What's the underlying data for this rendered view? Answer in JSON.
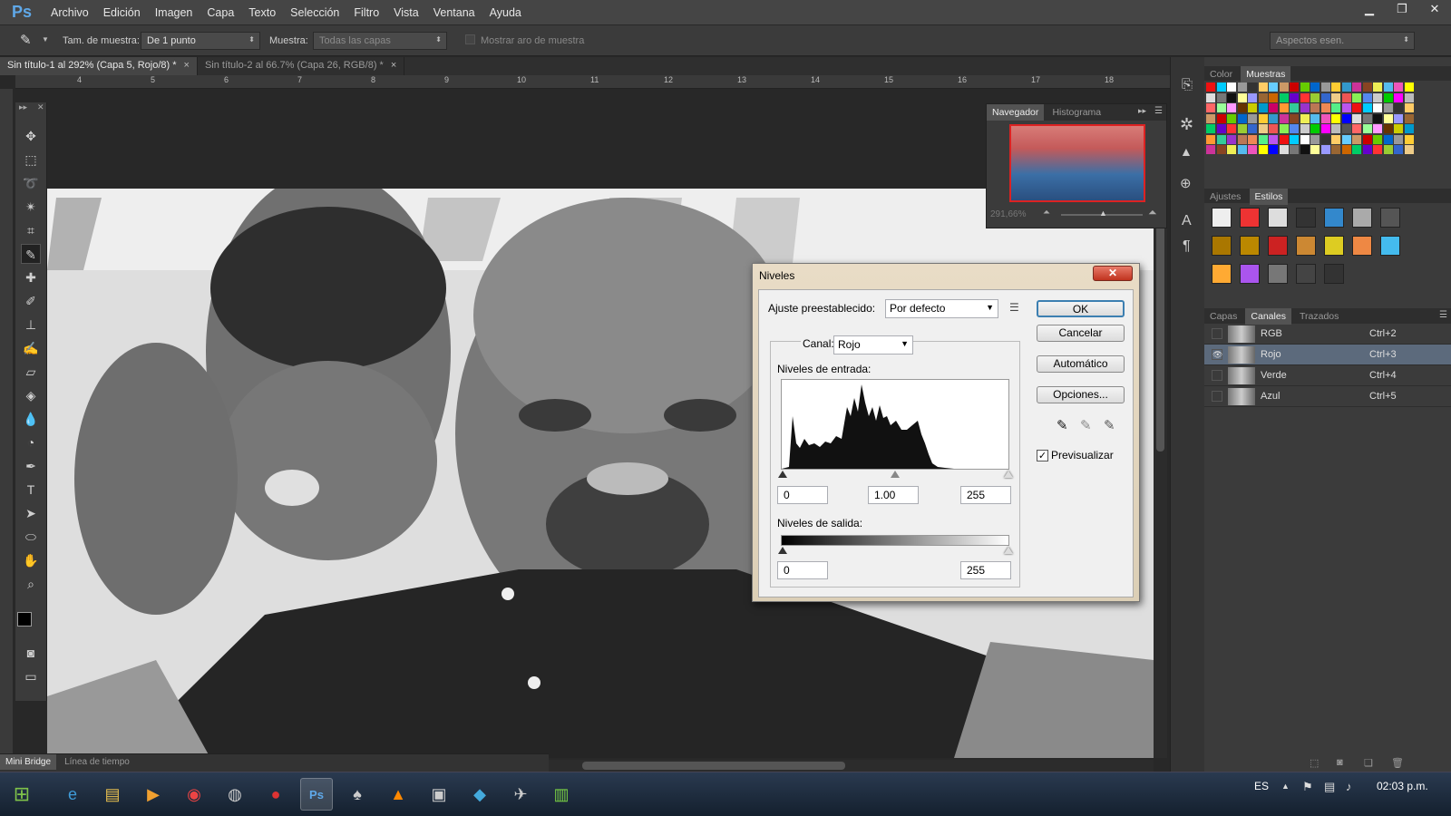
{
  "app": {
    "logo": "Ps"
  },
  "menu": [
    "Archivo",
    "Edición",
    "Imagen",
    "Capa",
    "Texto",
    "Selección",
    "Filtro",
    "Vista",
    "Ventana",
    "Ayuda"
  ],
  "options": {
    "sample_size_label": "Tam. de muestra:",
    "sample_size_value": "De 1 punto",
    "sample_label": "Muestra:",
    "sample_value": "Todas las capas",
    "show_ring_label": "Mostrar aro de muestra",
    "workspace_value": "Aspectos esen."
  },
  "doc_tabs": [
    {
      "label": "Sin título-1 al 292% (Capa 5, Rojo/8) *",
      "active": true
    },
    {
      "label": "Sin título-2 al 66.7% (Capa 26, RGB/8) *",
      "active": false
    }
  ],
  "ruler_ticks": [
    "4",
    "5",
    "6",
    "7",
    "8",
    "9",
    "10",
    "11",
    "12",
    "13",
    "14",
    "15",
    "16",
    "17",
    "18"
  ],
  "navigator": {
    "tabs": [
      "Navegador",
      "Histograma"
    ],
    "zoom": "291,66%"
  },
  "swatches_panel": {
    "tabs": [
      "Color",
      "Muestras"
    ]
  },
  "styles_panel": {
    "tabs": [
      "Ajustes",
      "Estilos"
    ]
  },
  "channels_panel": {
    "tabs": [
      "Capas",
      "Canales",
      "Trazados"
    ],
    "channels": [
      {
        "name": "RGB",
        "shortcut": "Ctrl+2"
      },
      {
        "name": "Rojo",
        "shortcut": "Ctrl+3"
      },
      {
        "name": "Verde",
        "shortcut": "Ctrl+4"
      },
      {
        "name": "Azul",
        "shortcut": "Ctrl+5"
      }
    ]
  },
  "levels_dialog": {
    "title": "Niveles",
    "preset_label": "Ajuste preestablecido:",
    "preset_value": "Por defecto",
    "channel_label": "Canal:",
    "channel_value": "Rojo",
    "input_label": "Niveles de entrada:",
    "input_values": [
      "0",
      "1.00",
      "255"
    ],
    "output_label": "Niveles de salida:",
    "output_values": [
      "0",
      "255"
    ],
    "buttons": {
      "ok": "OK",
      "cancel": "Cancelar",
      "auto": "Automático",
      "options": "Opciones..."
    },
    "preview_label": "Previsualizar",
    "preview_checked": true
  },
  "bottom_tabs": [
    "Mini Bridge",
    "Línea de tiempo"
  ],
  "taskbar": {
    "lang": "ES",
    "clock": "02:03 p.m."
  },
  "colors": {
    "accent": "#3c7fb1",
    "selected_channel": "#5c6a7c"
  }
}
